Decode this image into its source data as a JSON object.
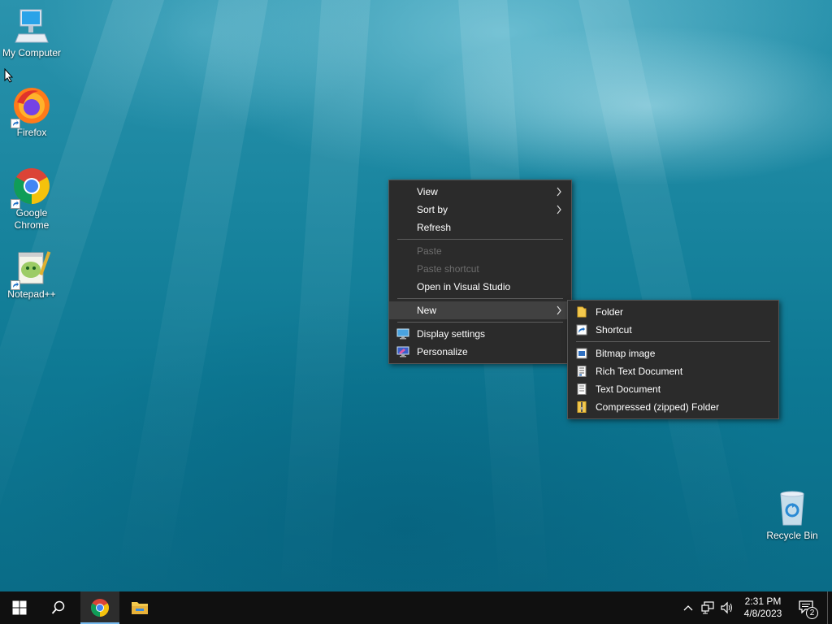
{
  "desktop": {
    "icons": [
      {
        "label": "My Computer",
        "icon": "computer-icon"
      },
      {
        "label": "Firefox",
        "icon": "firefox-icon"
      },
      {
        "label": "Google Chrome",
        "icon": "chrome-icon"
      },
      {
        "label": "Notepad++",
        "icon": "notepadpp-icon"
      },
      {
        "label": "Recycle Bin",
        "icon": "recycle-bin-icon"
      }
    ]
  },
  "context_menu": {
    "items": [
      {
        "label": "View",
        "submenu": true
      },
      {
        "label": "Sort by",
        "submenu": true
      },
      {
        "label": "Refresh"
      },
      {
        "label": "Paste",
        "disabled": true
      },
      {
        "label": "Paste shortcut",
        "disabled": true
      },
      {
        "label": "Open in Visual Studio"
      },
      {
        "label": "New",
        "submenu": true,
        "highlighted": true
      },
      {
        "label": "Display settings",
        "icon": "display-settings-icon"
      },
      {
        "label": "Personalize",
        "icon": "personalize-icon"
      }
    ]
  },
  "new_submenu": {
    "items": [
      {
        "label": "Folder",
        "icon": "folder-icon"
      },
      {
        "label": "Shortcut",
        "icon": "shortcut-icon"
      },
      {
        "label": "Bitmap image",
        "icon": "bitmap-icon"
      },
      {
        "label": "Rich Text Document",
        "icon": "rich-text-icon"
      },
      {
        "label": "Text Document",
        "icon": "text-document-icon"
      },
      {
        "label": "Compressed (zipped) Folder",
        "icon": "zip-folder-icon"
      }
    ]
  },
  "taskbar": {
    "pinned": [
      "start-icon",
      "search-icon",
      "chrome-icon",
      "file-explorer-icon"
    ],
    "active_app": "Google Chrome",
    "clock": {
      "time": "2:31 PM",
      "date": "4/8/2023"
    },
    "notification_count": "2"
  },
  "colors": {
    "menu_bg": "#2b2b2b",
    "menu_hover": "#414141",
    "disabled_text": "#6d6d6d",
    "taskbar_bg": "#101010",
    "accent": "#76b9ed"
  }
}
